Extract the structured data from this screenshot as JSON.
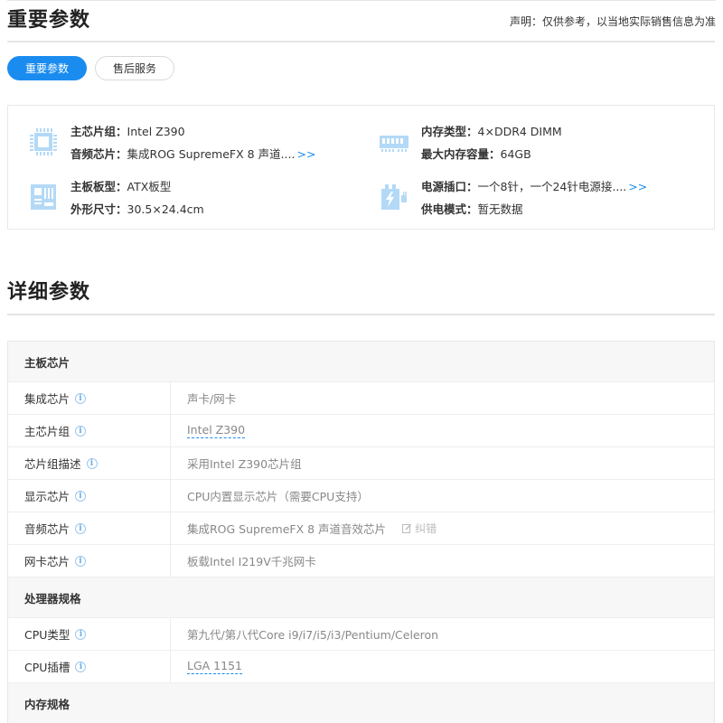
{
  "header": {
    "title": "重要参数",
    "disclaimer": "声明：仅供参考，以当地实际销售信息为准"
  },
  "tabs": [
    {
      "label": "重要参数",
      "active": true
    },
    {
      "label": "售后服务",
      "active": false
    }
  ],
  "summary": {
    "chipset_key": "主芯片组：",
    "chipset_val": "Intel Z390",
    "audio_key": "音频芯片：",
    "audio_val": "集成ROG SupremeFX 8 声道....",
    "audio_more": ">>",
    "memtype_key": "内存类型：",
    "memtype_val": "4×DDR4 DIMM",
    "memmax_key": "最大内存容量：",
    "memmax_val": "64GB",
    "board_key": "主板板型：",
    "board_val": "ATX板型",
    "size_key": "外形尺寸：",
    "size_val": "30.5×24.4cm",
    "power_key": "电源插口：",
    "power_val": "一个8针，一个24针电源接....",
    "power_more": ">>",
    "supply_key": "供电模式：",
    "supply_val": "暂无数据",
    "icon_color": "#b3d9f7"
  },
  "detail": {
    "title": "详细参数",
    "info_glyph": "i",
    "error_label": "纠错",
    "groups": {
      "g1": "主板芯片",
      "g2": "处理器规格",
      "g3": "内存规格"
    },
    "rows": {
      "r1": {
        "name": "集成芯片",
        "value": "声卡/网卡"
      },
      "r2": {
        "name": "主芯片组",
        "value": "Intel Z390"
      },
      "r3": {
        "name": "芯片组描述",
        "value": "采用Intel Z390芯片组"
      },
      "r4": {
        "name": "显示芯片",
        "value": "CPU内置显示芯片（需要CPU支持）"
      },
      "r5": {
        "name": "音频芯片",
        "value": "集成ROG SupremeFX 8 声道音效芯片"
      },
      "r6": {
        "name": "网卡芯片",
        "value": "板载Intel I219V千兆网卡"
      },
      "r7": {
        "name": "CPU类型",
        "value": "第九代/第八代Core i9/i7/i5/i3/Pentium/Celeron"
      },
      "r8": {
        "name": "CPU插槽",
        "value": "LGA 1151"
      }
    }
  }
}
